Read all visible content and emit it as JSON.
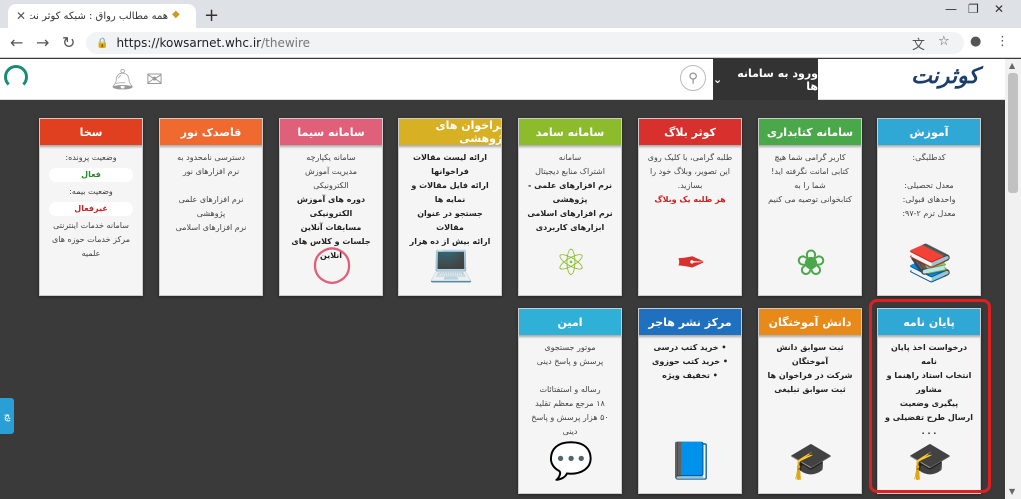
{
  "browser": {
    "tab_title": "همه مطالب رواق : شبکه کوثر نت",
    "url_host": "https://kowsarnet.whc.ir",
    "url_path": "/thewire"
  },
  "header": {
    "logo_text": "کوثرنت",
    "login_label": "ورود به سامانه ها"
  },
  "side_tab": "ﭻ",
  "cards": [
    {
      "id": "amozesh",
      "title": "آموزش",
      "color": "#2fa8d6",
      "lines": [
        "کدطلبگی:",
        "",
        "معدل تحصیلی:",
        "واحدهای قبولی:",
        "معدل ترم ۲-۹۷:"
      ],
      "icon": "📚"
    },
    {
      "id": "ketabdari",
      "title": "سامانه کتابداری",
      "color": "#4aa84a",
      "lines": [
        "کاربر گرامی شما هیچ کتابی امانت نگرفته اید! شما را به",
        "کتابخوانی توصیه می کنیم"
      ],
      "icon": "❀"
    },
    {
      "id": "kowsarblog",
      "title": "کوثر بلاگ",
      "color": "#d8302c",
      "lines": [
        "طلبه گرامی، با کلیک روی این تصویر، وبلاگ خود را بسازید.",
        "هر طلبه یک وبلاگ"
      ],
      "icon": "✒"
    },
    {
      "id": "samed",
      "title": "سامانه سامد",
      "color": "#8cbc2c",
      "lines": [
        "سامانه",
        "اشتراک منابع دیجیتال",
        "نرم افزارهای علمی - پژوهشی",
        "نرم افزارهای اسلامی",
        "ابزارهای کاربردی"
      ],
      "icon": "⚛"
    },
    {
      "id": "farakhan",
      "title": "فراخوان های پژوهشی",
      "color": "#d8b024",
      "lines": [
        "ارائه لیست مقالات فراخوانها",
        "ارائه فایل مقالات و نمایه ها",
        "جستجو در عنوان مقالات",
        "ارائه بیش از ده هزار مقاله"
      ],
      "icon": "💻"
    },
    {
      "id": "sima",
      "title": "سامانه سیما",
      "color": "#e0607a",
      "lines": [
        "سامانه یکپارچه",
        "مدیریت آموزش الکترونیکی",
        "دوره های آموزش الکترونیکی",
        "مسابقات آنلاین",
        "جلسات و کلاس های آنلاین"
      ],
      "icon": "◯"
    },
    {
      "id": "ghasedak",
      "title": "قاصدک نور",
      "color": "#f06a30",
      "lines": [
        "دسترسی نامحدود به",
        "نرم افزارهای نور",
        "",
        "نرم افزارهای علمی پژوهشی",
        "نرم افزارهای اسلامی"
      ],
      "icon": "✿"
    },
    {
      "id": "sakha",
      "title": "سخا",
      "color": "#e04020",
      "lines": [
        "وضعیت پرونده:",
        "وضعیت بیمه:",
        "سامانه خدمات اینترنتی",
        "مرکز خدمات حوزه های علمیه"
      ],
      "pill1": "فعال",
      "pill2": "غیرفعال",
      "icon": "🏢"
    },
    {
      "id": "payannameh",
      "title": "پایان نامه",
      "color": "#2fa8d6",
      "lines": [
        "درخواست اخذ پایان نامه",
        "انتخاب استاد راهنما و مشاور",
        "پیگیری وضعیت",
        "ارسال طرح تفضیلی و . . ."
      ],
      "icon": "🎓"
    },
    {
      "id": "daneshamookhtegan",
      "title": "دانش آموختگان",
      "color": "#e88a1a",
      "lines": [
        "ثبت سوابق دانش آموختگان",
        "شرکت در فراخوان ها",
        "ثبت سوابق تبلیغی"
      ],
      "icon": "🎓"
    },
    {
      "id": "hajar",
      "title": "مرکز نشر هاجر",
      "color": "#2070c0",
      "lines": [
        "خرید کتب درسی",
        "خرید کتب حوزوی",
        "تخفیف ویژه"
      ],
      "icon": "📘"
    },
    {
      "id": "amin",
      "title": "امین",
      "color": "#2fb0d6",
      "lines": [
        "موتور جستجوی",
        "پرسش و پاسخ دینی",
        "",
        "رساله و استفتائات",
        "۱۸ مرجع معظم تقلید",
        "۵۰ هزار پرسش و پاسخ دینی"
      ],
      "icon": "💬"
    }
  ]
}
